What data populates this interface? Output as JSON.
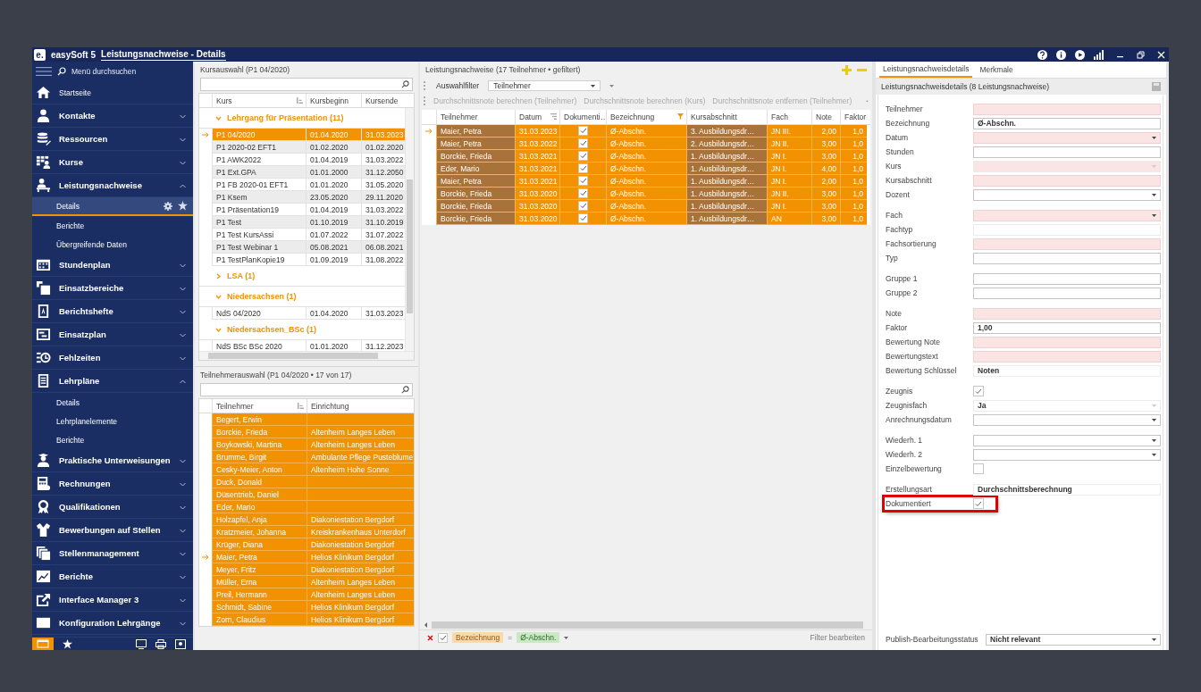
{
  "window": {
    "logo": "e.",
    "app_name": "easySoft 5",
    "title": "Leistungsnachweise - Details"
  },
  "sidebar": {
    "search_placeholder": "Menü durchsuchen",
    "items": [
      {
        "kind": "link",
        "label": "Startseite"
      },
      {
        "kind": "group",
        "label": "Kontakte",
        "expanded": false
      },
      {
        "kind": "group",
        "label": "Ressourcen",
        "expanded": false
      },
      {
        "kind": "group",
        "label": "Kurse",
        "expanded": false
      },
      {
        "kind": "group",
        "label": "Leistungsnachweise",
        "expanded": true,
        "children": [
          {
            "label": "Details",
            "selected": true
          },
          {
            "label": "Berichte",
            "selected": false
          },
          {
            "label": "Übergreifende Daten",
            "selected": false
          }
        ]
      },
      {
        "kind": "group",
        "label": "Stundenplan",
        "expanded": false
      },
      {
        "kind": "group",
        "label": "Einsatzbereiche",
        "expanded": false
      },
      {
        "kind": "group",
        "label": "Berichtshefte",
        "expanded": false
      },
      {
        "kind": "group",
        "label": "Einsatzplan",
        "expanded": false
      },
      {
        "kind": "group",
        "label": "Fehlzeiten",
        "expanded": false
      },
      {
        "kind": "group",
        "label": "Lehrpläne",
        "expanded": true,
        "children": [
          {
            "label": "Details",
            "selected": false
          },
          {
            "label": "Lehrplanelemente",
            "selected": false
          },
          {
            "label": "Berichte",
            "selected": false
          }
        ]
      },
      {
        "kind": "group",
        "label": "Praktische Unterweisungen",
        "expanded": false
      },
      {
        "kind": "group",
        "label": "Rechnungen",
        "expanded": false
      },
      {
        "kind": "group",
        "label": "Qualifikationen",
        "expanded": false
      },
      {
        "kind": "group",
        "label": "Bewerbungen auf Stellen",
        "expanded": false
      },
      {
        "kind": "group",
        "label": "Stellenmanagement",
        "expanded": false
      },
      {
        "kind": "group",
        "label": "Berichte",
        "expanded": false
      },
      {
        "kind": "group",
        "label": "Interface Manager 3",
        "expanded": false
      },
      {
        "kind": "group",
        "label": "Konfiguration Lehrgänge",
        "expanded": false
      }
    ]
  },
  "kursauswahl": {
    "title": "Kursauswahl (P1 04/2020)",
    "columns": [
      {
        "label": "Kurs",
        "sorted": true
      },
      {
        "label": "Kursbeginn",
        "sorted": false
      },
      {
        "label": "Kursende",
        "sorted": false
      }
    ],
    "groups": [
      {
        "label": "Lehrgang für Präsentation (11)",
        "expanded": true,
        "rows": [
          {
            "cells": [
              "P1 04/2020",
              "01.04.2020",
              "31.03.2023"
            ],
            "selected": true,
            "current": true
          },
          {
            "cells": [
              "P1 2020-02 EFT1",
              "01.02.2020",
              "01.02.2020"
            ],
            "selected": false,
            "current": false
          },
          {
            "cells": [
              "P1 AWK2022",
              "01.04.2019",
              "31.03.2022"
            ],
            "selected": false,
            "current": false
          },
          {
            "cells": [
              "P1 Ext.GPA",
              "01.01.2000",
              "31.12.2050"
            ],
            "selected": false,
            "current": false
          },
          {
            "cells": [
              "P1 FB 2020-01 EFT1",
              "01.01.2020",
              "31.05.2020"
            ],
            "selected": false,
            "current": false
          },
          {
            "cells": [
              "P1 Ksem",
              "23.05.2020",
              "29.11.2020"
            ],
            "selected": false,
            "current": false
          },
          {
            "cells": [
              "P1 Präsentation19",
              "01.04.2019",
              "31.03.2022"
            ],
            "selected": false,
            "current": false
          },
          {
            "cells": [
              "P1 Test",
              "01.10.2019",
              "31.10.2019"
            ],
            "selected": false,
            "current": false
          },
          {
            "cells": [
              "P1 Test KursAssi",
              "01.07.2022",
              "31.07.2022"
            ],
            "selected": false,
            "current": false
          },
          {
            "cells": [
              "P1 Test Webinar 1",
              "05.08.2021",
              "06.08.2021"
            ],
            "selected": false,
            "current": false
          },
          {
            "cells": [
              "P1 TestPlanKopie19",
              "01.09.2019",
              "31.08.2022"
            ],
            "selected": false,
            "current": false
          }
        ]
      },
      {
        "label": "LSA (1)",
        "expanded": false
      },
      {
        "label": "Niedersachsen (1)",
        "expanded": true,
        "rows": [
          {
            "cells": [
              "NdS 04/2020",
              "01.04.2020",
              "31.03.2023"
            ],
            "selected": false,
            "current": false
          }
        ]
      },
      {
        "label": "Niedersachsen_BSc (1)",
        "expanded": true,
        "rows": [
          {
            "cells": [
              "NdS BSc BSc 2020",
              "01.01.2020",
              "31.12.2023"
            ],
            "selected": false,
            "current": false
          }
        ]
      }
    ]
  },
  "teilnehmerauswahl": {
    "title": "Teilnehmerauswahl (P1 04/2020 • 17 von 17)",
    "columns": [
      {
        "label": "Teilnehmer",
        "sorted": true
      },
      {
        "label": "Einrichtung",
        "sorted": false
      }
    ],
    "rows": [
      {
        "name": "Begert, Erwin",
        "selected": true,
        "current": false
      },
      {
        "name": "Borckie, Frieda",
        "einrichtung": "Altenheim Langes Leben",
        "selected": true,
        "current": false
      },
      {
        "name": "Boykowski, Martina",
        "einrichtung": "Altenheim Langes Leben",
        "selected": true,
        "current": false
      },
      {
        "name": "Brumme, Birgit",
        "einrichtung": "Ambulante Pflege Pusteblume",
        "selected": true,
        "current": false
      },
      {
        "name": "Cesky-Meier, Anton",
        "einrichtung": "Altenheim Hohe Sonne",
        "selected": true,
        "current": false
      },
      {
        "name": "Duck, Donald",
        "selected": true,
        "current": false
      },
      {
        "name": "Düsentrieb, Daniel",
        "selected": true,
        "current": false
      },
      {
        "name": "Eder, Mario",
        "selected": true,
        "current": false
      },
      {
        "name": "Holzapfel, Anja",
        "einrichtung": "Diakoniestation Bergdorf",
        "selected": true,
        "current": false
      },
      {
        "name": "Kratzmeier, Johanna",
        "einrichtung": "Kreiskrankenhaus Unterdorf",
        "selected": true,
        "current": false
      },
      {
        "name": "Krüger, Diana",
        "einrichtung": "Diakoniestation Bergdorf",
        "selected": true,
        "current": false
      },
      {
        "name": "Maier, Petra",
        "einrichtung": "Helios Klinikum Bergdorf",
        "selected": true,
        "current": true
      },
      {
        "name": "Meyer, Fritz",
        "einrichtung": "Diakoniestation Bergdorf",
        "selected": true,
        "current": false
      },
      {
        "name": "Müller, Erna",
        "einrichtung": "Altenheim Langes Leben",
        "selected": true,
        "current": false
      },
      {
        "name": "Preil, Hermann",
        "einrichtung": "Altenheim Langes Leben",
        "selected": true,
        "current": false
      },
      {
        "name": "Schmidt, Sabine",
        "einrichtung": "Helios Klinikum Bergdorf",
        "selected": true,
        "current": false
      },
      {
        "name": "Zorn, Claudius",
        "einrichtung": "Helios Klinikum Bergdorf",
        "selected": true,
        "current": false
      }
    ]
  },
  "leistungsnachweise": {
    "title": "Leistungsnachweise (17 Teilnehmer • gefiltert)",
    "filter_label": "Auswahlfilter",
    "filter_value": "Teilnehmer",
    "actions": [
      {
        "label": "Durchschnittsnote berechnen (Teilnehmer)",
        "disabled": true
      },
      {
        "label": "Durchschnittsnote berechnen (Kurs)",
        "disabled": true
      },
      {
        "label": "Durchschnittsnote entfernen (Teilnehmer)",
        "disabled": true
      }
    ],
    "columns": [
      {
        "label": "Teilnehmer",
        "kind": "text",
        "readonly": true,
        "sorted": false,
        "filtered": false
      },
      {
        "label": "Datum",
        "kind": "text",
        "readonly": false,
        "sorted": true,
        "filtered": false
      },
      {
        "label": "Dokumenti…",
        "kind": "check",
        "readonly": false,
        "sorted": false,
        "filtered": false
      },
      {
        "label": "Bezeichnung",
        "kind": "text",
        "readonly": false,
        "sorted": false,
        "filtered": true
      },
      {
        "label": "Kursabschnitt",
        "kind": "text",
        "readonly": true,
        "sorted": false,
        "filtered": false
      },
      {
        "label": "Fach",
        "kind": "text",
        "readonly": false,
        "sorted": false,
        "filtered": false
      },
      {
        "label": "Note",
        "kind": "number",
        "readonly": false,
        "sorted": false,
        "filtered": false
      },
      {
        "label": "Faktor",
        "kind": "number",
        "readonly": false,
        "sorted": false,
        "filtered": false
      }
    ],
    "rows": [
      {
        "selected": true,
        "current": true,
        "cells": [
          "Maier, Petra",
          "31.03.2023",
          true,
          "Ø-Abschn.",
          "3. Ausbildungsdr…",
          "JN III.",
          "2,00",
          "1,0"
        ]
      },
      {
        "selected": true,
        "current": false,
        "cells": [
          "Maier, Petra",
          "31.03.2022",
          true,
          "Ø-Abschn.",
          "2. Ausbildungsdr…",
          "JN II.",
          "3,00",
          "1,0"
        ]
      },
      {
        "selected": true,
        "current": false,
        "cells": [
          "Borckie, Frieda",
          "31.03.2021",
          true,
          "Ø-Abschn.",
          "1. Ausbildungsdr…",
          "JN I.",
          "3,00",
          "1,0"
        ]
      },
      {
        "selected": true,
        "current": false,
        "cells": [
          "Eder, Mario",
          "31.03.2021",
          true,
          "Ø-Abschn.",
          "1. Ausbildungsdr…",
          "JN I.",
          "4,00",
          "1,0"
        ]
      },
      {
        "selected": true,
        "current": false,
        "cells": [
          "Maier, Petra",
          "31.03.2021",
          true,
          "Ø-Abschn.",
          "1. Ausbildungsdr…",
          "JN I.",
          "2,00",
          "1,0"
        ]
      },
      {
        "selected": true,
        "current": false,
        "cells": [
          "Borckie, Frieda",
          "31.03.2020",
          true,
          "Ø-Abschn.",
          "1. Ausbildungsdr…",
          "JN II.",
          "3,00",
          "1,0"
        ]
      },
      {
        "selected": true,
        "current": false,
        "cells": [
          "Borckie, Frieda",
          "31.03.2020",
          true,
          "Ø-Abschn.",
          "1. Ausbildungsdr…",
          "JN I.",
          "3,00",
          "1,0"
        ]
      },
      {
        "selected": true,
        "current": false,
        "cells": [
          "Borckie, Frieda",
          "31.03.2020",
          true,
          "Ø-Abschn.",
          "1. Ausbildungsdr…",
          "AN",
          "3,00",
          "1,0"
        ]
      }
    ],
    "filter_bar": {
      "active": true,
      "field": "Bezeichnung",
      "operator": "=",
      "value": "Ø-Abschn.",
      "edit_label": "Filter bearbeiten"
    }
  },
  "details": {
    "tabs": [
      {
        "label": "Leistungsnachweisdetails",
        "selected": true
      },
      {
        "label": "Merkmale",
        "selected": false
      }
    ],
    "header": "Leistungsnachweisdetails (8 Leistungsnachweise)",
    "field_groups": [
      [
        {
          "label": "Teilnehmer",
          "kind": "text",
          "required": true,
          "readonly": false
        },
        {
          "label": "Bezeichnung",
          "kind": "text",
          "value": "Ø-Abschn.",
          "required": false,
          "readonly": false
        },
        {
          "label": "Datum",
          "kind": "select",
          "required": true,
          "readonly": false
        },
        {
          "label": "Stunden",
          "kind": "text",
          "required": false,
          "readonly": false
        },
        {
          "label": "Kurs",
          "kind": "select",
          "required": true,
          "readonly": true
        },
        {
          "label": "Kursabschnitt",
          "kind": "text",
          "required": true,
          "readonly": false
        },
        {
          "label": "Dozent",
          "kind": "select",
          "required": false,
          "readonly": false
        }
      ],
      [
        {
          "label": "Fach",
          "kind": "select",
          "required": true,
          "readonly": false
        },
        {
          "label": "Fachtyp",
          "kind": "text",
          "required": false,
          "readonly": true
        },
        {
          "label": "Fachsortierung",
          "kind": "text",
          "required": true,
          "readonly": false
        },
        {
          "label": "Typ",
          "kind": "text",
          "required": false,
          "readonly": false
        }
      ],
      [
        {
          "label": "Gruppe 1",
          "kind": "text",
          "required": false,
          "readonly": false
        },
        {
          "label": "Gruppe 2",
          "kind": "text",
          "required": false,
          "readonly": false
        }
      ],
      [
        {
          "label": "Note",
          "kind": "text",
          "required": true,
          "readonly": false
        },
        {
          "label": "Faktor",
          "kind": "text",
          "value": "1,00",
          "required": false,
          "readonly": false
        },
        {
          "label": "Bewertung Note",
          "kind": "text",
          "required": true,
          "readonly": false
        },
        {
          "label": "Bewertungstext",
          "kind": "text",
          "required": true,
          "readonly": false
        },
        {
          "label": "Bewertung Schlüssel",
          "kind": "text",
          "value": "Noten",
          "required": false,
          "readonly": true
        }
      ],
      [
        {
          "label": "Zeugnis",
          "kind": "checkbox",
          "checked": true,
          "highlighted": false
        },
        {
          "label": "Zeugnisfach",
          "kind": "select",
          "value": "Ja",
          "required": false,
          "readonly": true
        },
        {
          "label": "Anrechnungsdatum",
          "kind": "select",
          "required": false,
          "readonly": false
        }
      ],
      [
        {
          "label": "Wiederh. 1",
          "kind": "select",
          "required": false,
          "readonly": false
        },
        {
          "label": "Wiederh. 2",
          "kind": "select",
          "required": false,
          "readonly": false
        },
        {
          "label": "Einzelbewertung",
          "kind": "checkbox",
          "checked": false,
          "highlighted": false
        }
      ],
      [
        {
          "label": "Erstellungsart",
          "kind": "text",
          "value": "Durchschnittsberechnung",
          "required": false,
          "readonly": true
        },
        {
          "label": "Dokumentiert",
          "kind": "checkbox",
          "checked": true,
          "highlighted": true
        }
      ]
    ],
    "bottom_field": {
      "label": "Publish-Bearbeitungsstatus",
      "kind": "select",
      "value": "Nicht relevant",
      "required": false,
      "readonly": false
    }
  }
}
